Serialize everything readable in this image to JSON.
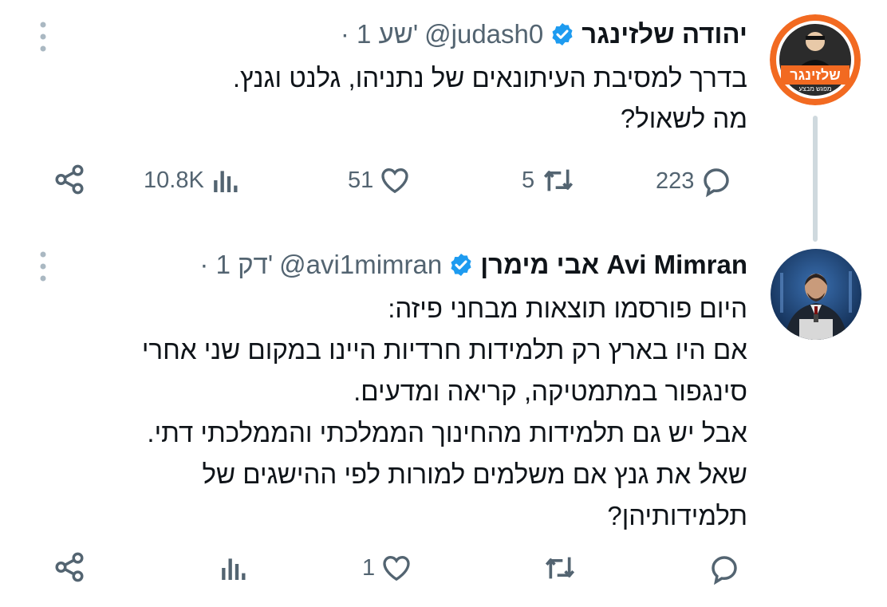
{
  "tweets": [
    {
      "author": {
        "name": "יהודה שלזינגר",
        "handle": "@judash0",
        "time": "· 1 שע'",
        "avatar_text": "שלזינגר",
        "avatar_subtext": "מפגש מבצע"
      },
      "lines": [
        "בדרך למסיבת העיתונאים של נתניהו, גלנט וגנץ.",
        "מה לשאול?"
      ],
      "stats": {
        "replies": "223",
        "retweets": "5",
        "likes": "51",
        "views": "10.8K"
      }
    },
    {
      "author": {
        "name": "אבי מימרן Avi Mimran",
        "handle": "@avi1mimran",
        "time": "· 1 דק'"
      },
      "lines": [
        "היום פורסמו תוצאות מבחני פיזה:",
        "אם היו בארץ רק תלמידות חרדיות היינו במקום שני אחרי",
        "סינגפור במתמטיקה, קריאה ומדעים.",
        "אבל יש גם תלמידות מהחינוך הממלכתי והממלכתי דתי.",
        "שאל את גנץ אם משלמים למורות לפי ההישגים של",
        "תלמידותיהן?"
      ],
      "stats": {
        "replies": "",
        "retweets": "",
        "likes": "1",
        "views": ""
      }
    }
  ],
  "colors": {
    "text": "#0f1419",
    "secondary": "#536471",
    "verified": "#1d9bf0",
    "thread_line": "#cfd9de",
    "avatar1_ring": "#f26a21"
  },
  "icons": [
    "more-vert-icon",
    "verified-badge-icon",
    "share-icon",
    "views-icon",
    "like-icon",
    "retweet-icon",
    "reply-icon"
  ]
}
